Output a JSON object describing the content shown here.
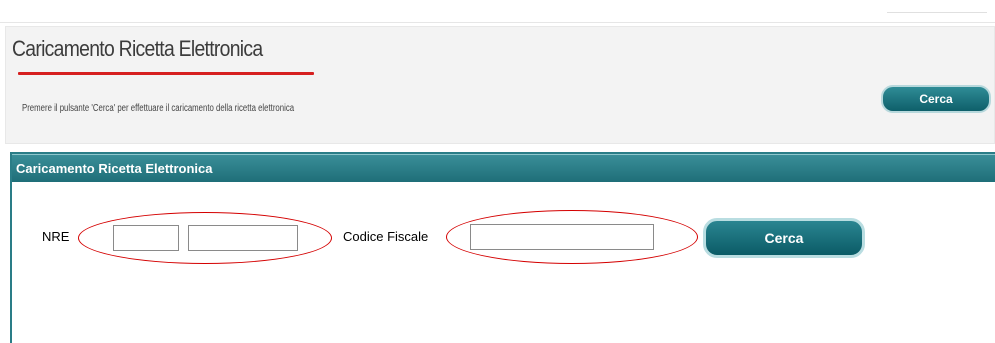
{
  "header": {
    "title": "Caricamento Ricetta Elettronica",
    "instructions": "Premere il pulsante 'Cerca' per effettuare il caricamento della ricetta elettronica",
    "search_button": "Cerca"
  },
  "panel": {
    "title": "Caricamento Ricetta Elettronica",
    "nre_label": "NRE",
    "nre_part1_value": "",
    "nre_part2_value": "",
    "codice_fiscale_label": "Codice Fiscale",
    "codice_fiscale_value": "",
    "search_button": "Cerca"
  },
  "colors": {
    "accent_teal": "#1f6e78",
    "underline_red": "#d61f1f",
    "annotation_red": "#d40000"
  }
}
